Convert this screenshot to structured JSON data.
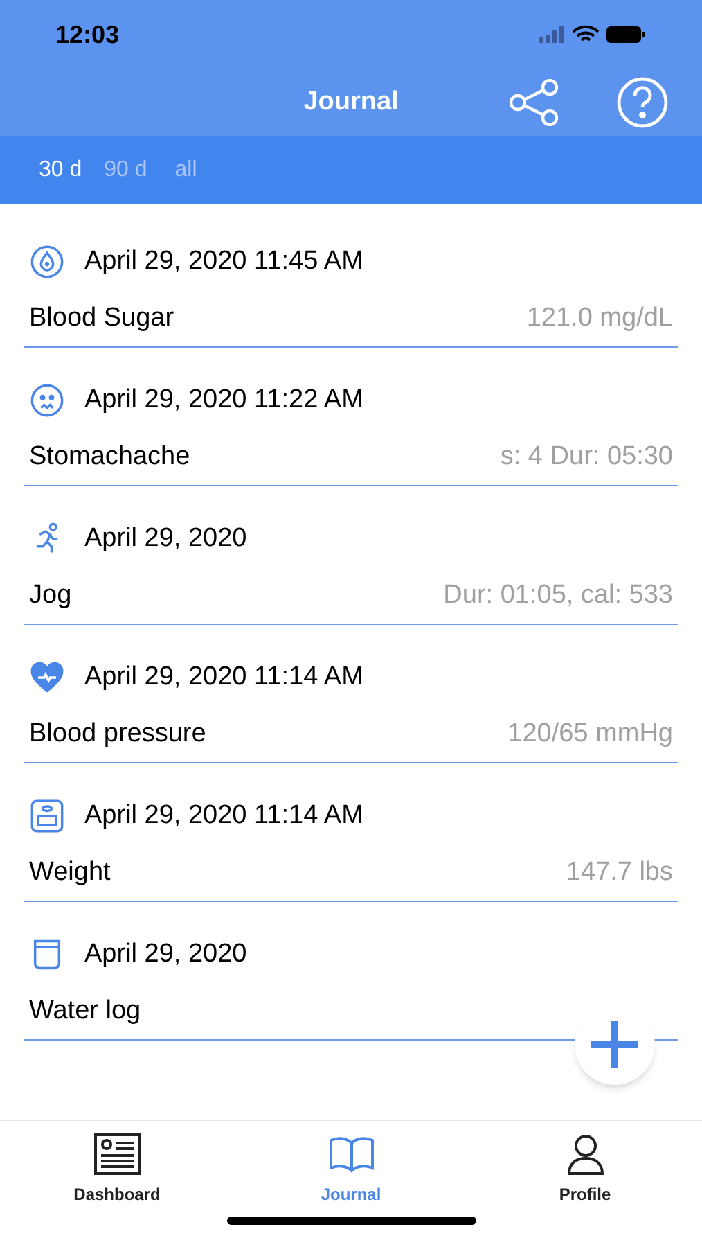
{
  "status_bar": {
    "time": "12:03"
  },
  "nav": {
    "title": "Journal"
  },
  "filters": [
    {
      "label": "30 d",
      "selected": true
    },
    {
      "label": "90 d",
      "selected": false
    },
    {
      "label": "all",
      "selected": false
    }
  ],
  "entries": [
    {
      "kind": "sugar",
      "date": "April 29, 2020 11:45 AM",
      "name": "Blood Sugar",
      "value": "121.0 mg/dL"
    },
    {
      "kind": "symptom",
      "date": "April 29, 2020 11:22 AM",
      "name": "Stomachache",
      "value": "s: 4 Dur: 05:30"
    },
    {
      "kind": "exercise",
      "date": "April 29, 2020",
      "name": "Jog",
      "value": "Dur: 01:05, cal: 533"
    },
    {
      "kind": "pressure",
      "date": "April 29, 2020 11:14 AM",
      "name": "Blood pressure",
      "value": "120/65 mmHg"
    },
    {
      "kind": "weight",
      "date": "April 29, 2020 11:14 AM",
      "name": "Weight",
      "value": "147.7 lbs"
    },
    {
      "kind": "water",
      "date": "April 29, 2020",
      "name": "Water log"
    }
  ],
  "tabs": [
    {
      "kind": "dashboard",
      "label": "Dashboard",
      "selected": false
    },
    {
      "kind": "journal",
      "label": "Journal",
      "selected": true
    },
    {
      "kind": "profile",
      "label": "Profile",
      "selected": false
    }
  ]
}
